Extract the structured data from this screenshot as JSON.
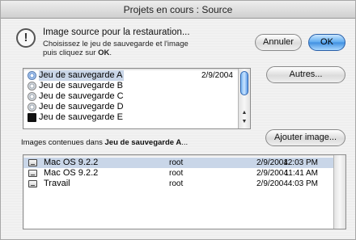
{
  "window": {
    "title": "Projets en cours : Source"
  },
  "message": {
    "title": "Image source pour la restauration...",
    "line1": "Choisissez le jeu de sauvegarde et l'image",
    "line2_prefix": "puis cliquez sur ",
    "line2_bold": "OK",
    "line2_suffix": "."
  },
  "buttons": {
    "cancel": "Annuler",
    "ok": "OK",
    "others": "Autres...",
    "add_image": "Ajouter image..."
  },
  "backup_sets": [
    {
      "label": "Jeu de sauvegarde A",
      "date": "2/9/2004",
      "icon": "disc-blue-icon",
      "selected": true
    },
    {
      "label": "Jeu de sauvegarde B",
      "date": "",
      "icon": "disc-icon",
      "selected": false
    },
    {
      "label": "Jeu de sauvegarde C",
      "date": "",
      "icon": "disc-icon",
      "selected": false
    },
    {
      "label": "Jeu de sauvegarde D",
      "date": "",
      "icon": "disc-icon",
      "selected": false
    },
    {
      "label": "Jeu de sauvegarde E",
      "date": "",
      "icon": "tape-icon",
      "selected": false
    }
  ],
  "images_label": {
    "prefix": "Images contenues dans ",
    "bold": "Jeu de sauvegarde A",
    "suffix": "..."
  },
  "images": [
    {
      "name": "Mac OS 9.2.2",
      "owner": "root",
      "date": "2/9/2004",
      "time": "12:03 PM",
      "selected": true
    },
    {
      "name": "Mac OS 9.2.2",
      "owner": "root",
      "date": "2/9/2004",
      "time": "11:41 AM",
      "selected": false
    },
    {
      "name": "Travail",
      "owner": "root",
      "date": "2/9/2004",
      "time": "4:03 PM",
      "selected": false
    }
  ],
  "colors": {
    "default_button": "#4a9be8",
    "selection": "#c9d6e8"
  }
}
